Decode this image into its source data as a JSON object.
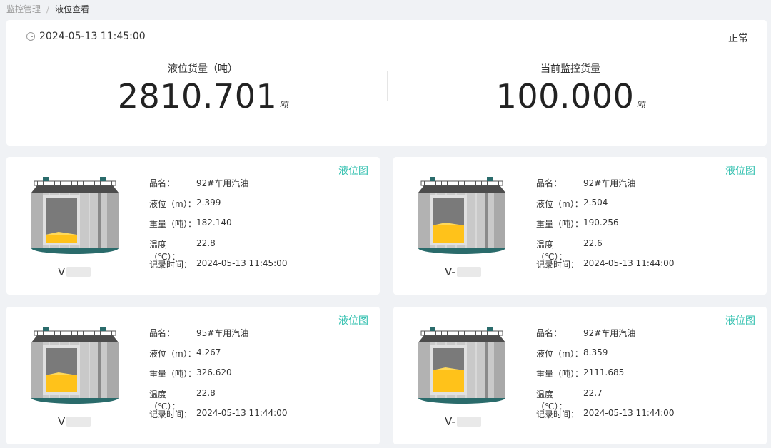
{
  "breadcrumb": {
    "parent": "监控管理",
    "separator": "/",
    "current": "液位查看"
  },
  "summary": {
    "timestamp": "2024-05-13 11:45:00",
    "status": "正常",
    "level_label": "液位货量（吨）",
    "level_value": "2810.701",
    "level_unit": "吨",
    "monitor_label": "当前监控货量",
    "monitor_value": "100.000",
    "monitor_unit": "吨"
  },
  "labels": {
    "chart_link": "液位图",
    "product": "品名：",
    "level": "液位（m）：",
    "weight": "重量（吨）：",
    "temp": "温度（℃）：",
    "record_time": "记录时间："
  },
  "tanks": [
    {
      "name": "V",
      "product": "92#车用汽油",
      "level": "2.399",
      "weight": "182.140",
      "temp": "22.8",
      "time": "2024-05-13 11:45:00",
      "fill_fraction": 0.17
    },
    {
      "name": "V-",
      "product": "92#车用汽油",
      "level": "2.504",
      "weight": "190.256",
      "temp": "22.6",
      "time": "2024-05-13 11:44:00",
      "fill_fraction": 0.38
    },
    {
      "name": "V",
      "product": "95#车用汽油",
      "level": "4.267",
      "weight": "326.620",
      "temp": "22.8",
      "time": "2024-05-13 11:44:00",
      "fill_fraction": 0.38
    },
    {
      "name": "V-",
      "product": "92#车用汽油",
      "level": "8.359",
      "weight": "2111.685",
      "temp": "22.7",
      "time": "2024-05-13 11:44:00",
      "fill_fraction": 0.5
    }
  ],
  "colors": {
    "accent": "#2ebfae",
    "fuel": "#ffc21a",
    "tank_base": "#2a6b6b"
  }
}
